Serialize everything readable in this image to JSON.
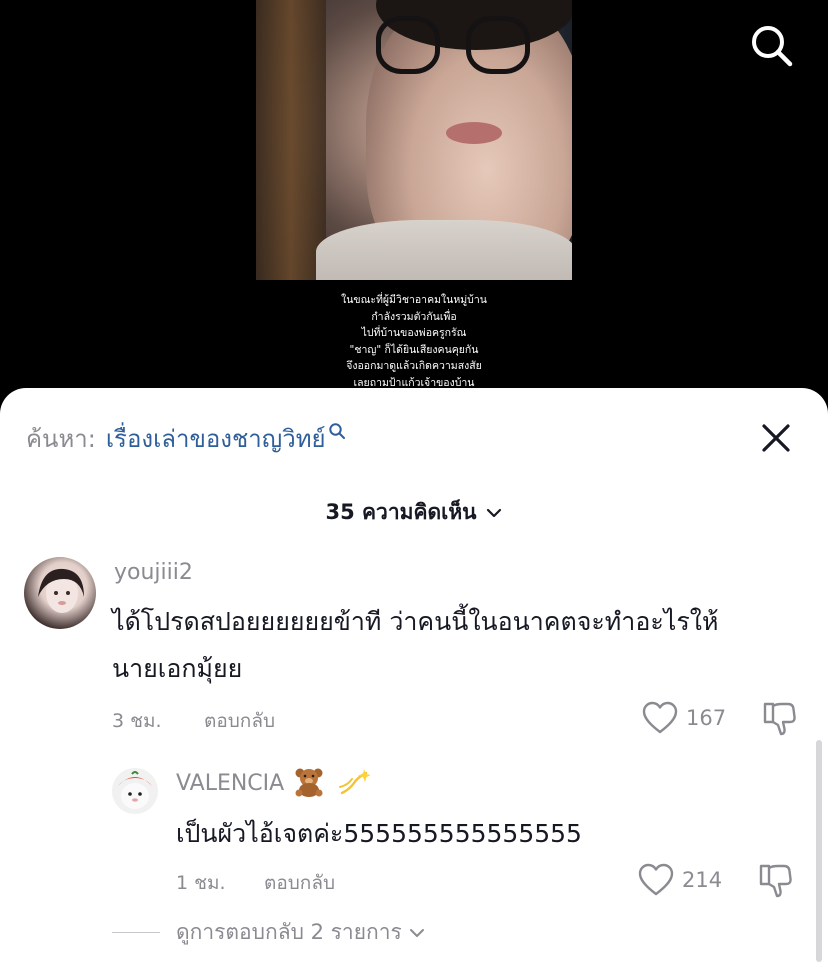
{
  "video": {
    "caption_lines": [
      "ในขณะที่ผู้มีวิชาอาคมในหมู่บ้าน",
      "กำลังรวมตัวกันเพื่อ",
      "ไปที่บ้านของพ่อครูกรัณ",
      "\"ชาญ\" ก็ได้ยินเสียงคนคุยกัน",
      "จึงออกมาดูแล้วเกิดความสงสัย",
      "เลยถามป้าแก้วเจ้าของบ้าน"
    ],
    "search_icon": "search-icon"
  },
  "sheet": {
    "search_prefix": "ค้นหา:",
    "search_query": "เรื่องเล่าของชาญวิทย์",
    "close_icon": "close-icon",
    "comment_count_label": "35 ความคิดเห็น"
  },
  "comments": [
    {
      "username": "youjiii2",
      "text_lines": [
        "ได้โปรดสปอยยยยยยข้าที ว่าคนนี้ในอนาคตจะทำอะไรให้",
        "นายเอกมุ้ยย"
      ],
      "time": "3 ชม.",
      "reply_label": "ตอบกลับ",
      "likes": "167"
    },
    {
      "username": "VALENCIA",
      "text": "เป็นผัวไอ้เจตค่ะ555555555555555",
      "time": "1 ชม.",
      "reply_label": "ตอบกลับ",
      "likes": "214"
    }
  ],
  "view_replies_label": "ดูการตอบกลับ 2 รายการ",
  "colors": {
    "link_blue": "#2f5f9a",
    "muted_gray": "#8a8b91",
    "text_dark": "#161823"
  }
}
